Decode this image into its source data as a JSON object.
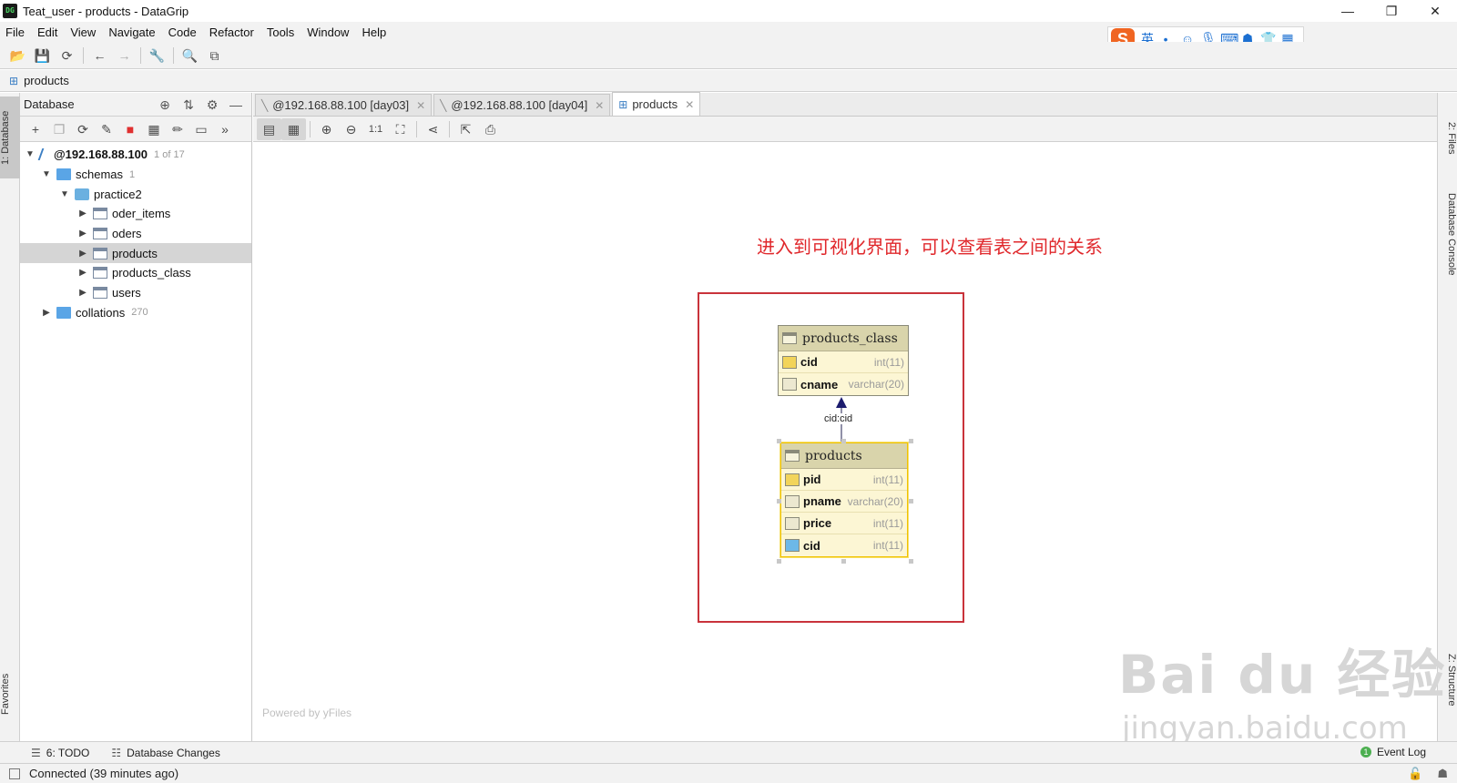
{
  "window": {
    "title": "Teat_user - products - DataGrip",
    "logo_text": "DG",
    "controls": [
      "—",
      "❐",
      "✕"
    ]
  },
  "menu": [
    "File",
    "Edit",
    "View",
    "Navigate",
    "Code",
    "Refactor",
    "Tools",
    "Window",
    "Help"
  ],
  "ime": {
    "logo": "S",
    "lang": "英"
  },
  "navbar": {
    "crumb": "products"
  },
  "left_strip": {
    "database_tab": "1: Database",
    "favorites_tab": "Favorites"
  },
  "right_strip": {
    "files_tab": "2: Files",
    "console_tab": "Database Console",
    "structure_tab": "Z: Structure"
  },
  "db_panel": {
    "title": "Database",
    "tree": [
      {
        "label": "@192.168.88.100",
        "count": "1 of 17",
        "level": 0,
        "expanded": true,
        "icon": "connection-icon",
        "bold": true
      },
      {
        "label": "schemas",
        "count": "1",
        "level": 1,
        "expanded": true,
        "icon": "folder-icon"
      },
      {
        "label": "practice2",
        "count": "",
        "level": 2,
        "expanded": true,
        "icon": "schema-icon"
      },
      {
        "label": "oder_items",
        "count": "",
        "level": 3,
        "expanded": false,
        "icon": "table-icon"
      },
      {
        "label": "oders",
        "count": "",
        "level": 3,
        "expanded": false,
        "icon": "table-icon"
      },
      {
        "label": "products",
        "count": "",
        "level": 3,
        "expanded": false,
        "icon": "table-icon",
        "selected": true
      },
      {
        "label": "products_class",
        "count": "",
        "level": 3,
        "expanded": false,
        "icon": "table-icon"
      },
      {
        "label": "users",
        "count": "",
        "level": 3,
        "expanded": false,
        "icon": "table-icon"
      },
      {
        "label": "collations",
        "count": "270",
        "level": 1,
        "expanded": false,
        "icon": "folder-icon"
      }
    ]
  },
  "tabs": [
    {
      "label": "@192.168.88.100 [day03]",
      "active": false
    },
    {
      "label": "@192.168.88.100 [day04]",
      "active": false
    },
    {
      "label": "products",
      "active": true
    }
  ],
  "diagram": {
    "annotation": "进入到可视化界面，可以查看表之间的关系",
    "relation_label": "cid:cid",
    "powered_by": "Powered by yFiles",
    "entities": {
      "products_class": {
        "name": "products_class",
        "columns": [
          {
            "name": "cid",
            "type": "int(11)",
            "kind": "key"
          },
          {
            "name": "cname",
            "type": "varchar(20)",
            "kind": "column"
          }
        ]
      },
      "products": {
        "name": "products",
        "columns": [
          {
            "name": "pid",
            "type": "int(11)",
            "kind": "key"
          },
          {
            "name": "pname",
            "type": "varchar(20)",
            "kind": "column"
          },
          {
            "name": "price",
            "type": "int(11)",
            "kind": "column"
          },
          {
            "name": "cid",
            "type": "int(11)",
            "kind": "fk"
          }
        ]
      }
    }
  },
  "bottom": {
    "todo": "6: TODO",
    "db_changes": "Database Changes",
    "event_log": "Event Log",
    "event_count": "1"
  },
  "status": {
    "text": "Connected (39 minutes ago)"
  },
  "watermark": {
    "text": "Bai du 经验",
    "url": "jingyan.baidu.com"
  },
  "colors": {
    "annotation": "#e0282c",
    "redbox": "#c9333b",
    "entity_bg": "#fcf6d4",
    "entity_head": "#d9d4ab",
    "relation_arrow": "#1c1c6e"
  }
}
